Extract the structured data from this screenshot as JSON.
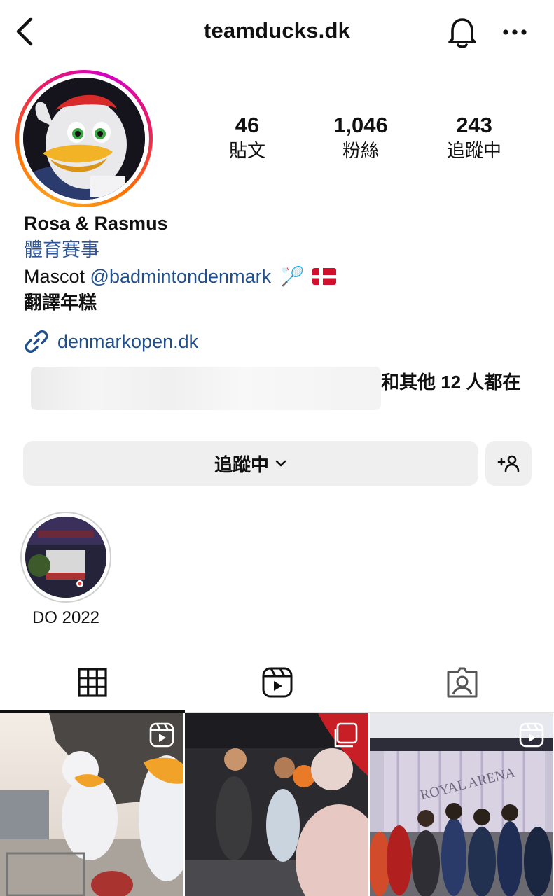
{
  "header": {
    "title": "teamducks.dk"
  },
  "stats": [
    {
      "value": "46",
      "label": "貼文"
    },
    {
      "value": "1,046",
      "label": "粉絲"
    },
    {
      "value": "243",
      "label": "追蹤中"
    }
  ],
  "bio": {
    "name": "Rosa & Rasmus",
    "category": "體育賽事",
    "line_prefix": "Mascot ",
    "mention": "@badmintondenmark",
    "emoji": "🏸",
    "translate": "翻譯年糕",
    "link": "denmarkopen.dk"
  },
  "followed_by": {
    "text": "和其他 12 人都在"
  },
  "actions": {
    "following_label": "追蹤中"
  },
  "highlights": [
    {
      "label": "DO 2022"
    }
  ],
  "tabs": [
    "posts-grid-icon",
    "reels-icon",
    "tagged-icon"
  ],
  "grid_posts": [
    {
      "type": "reel",
      "badge": "reels-icon"
    },
    {
      "type": "carousel",
      "badge": "carousel-icon"
    },
    {
      "type": "reel",
      "badge": "reels-icon",
      "sign_text": "ROYAL ARENA"
    }
  ],
  "colors": {
    "link": "#1f4f8f",
    "button_bg": "#efefef",
    "story_ring_start": "#f9a825",
    "story_ring_end": "#d300c5"
  }
}
